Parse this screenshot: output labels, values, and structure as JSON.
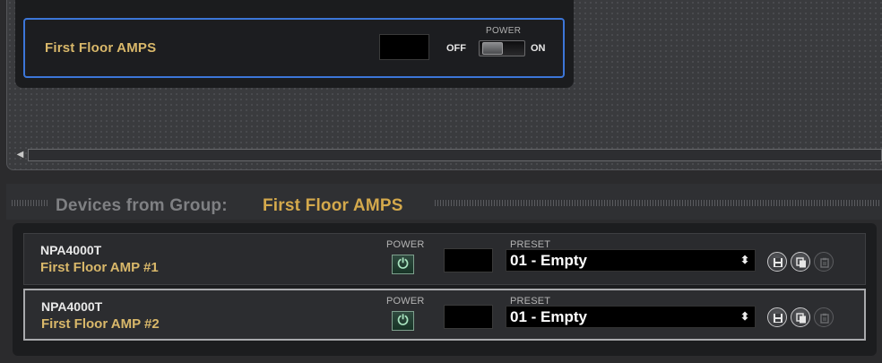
{
  "group_panel": {
    "group_name": "First Floor AMPS",
    "power_label": "POWER",
    "off_label": "OFF",
    "on_label": "ON",
    "power_state": "off"
  },
  "devices_header": {
    "label": "Devices from Group:",
    "group_name": "First Floor AMPS"
  },
  "devices": [
    {
      "model": "NPA4000T",
      "name": "First Floor AMP #1",
      "power_label": "POWER",
      "power_icon": "⏻",
      "preset_label": "PRESET",
      "preset_value": "01 - Empty",
      "selected": false
    },
    {
      "model": "NPA4000T",
      "name": "First Floor AMP #2",
      "power_label": "POWER",
      "power_icon": "⏻",
      "preset_label": "PRESET",
      "preset_value": "01 - Empty",
      "selected": true
    }
  ],
  "icons": {
    "scroll_left": "◀",
    "select_arrows": "⬍",
    "save": "save-icon",
    "copy": "copy-icon",
    "paste": "paste-icon"
  },
  "colors": {
    "accent_blue": "#3c76d8",
    "group_gold": "#d9b86a",
    "power_green": "#a8e3bf"
  }
}
